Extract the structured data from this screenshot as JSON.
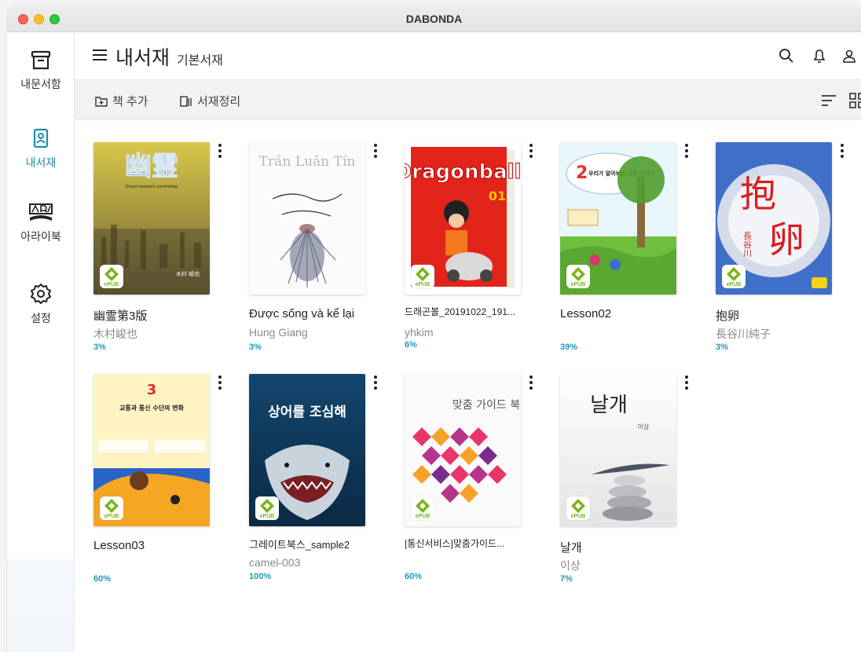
{
  "window": {
    "title": "DABONDA"
  },
  "sidebar": {
    "items": [
      {
        "label": "내문서함",
        "icon": "archive-box-icon",
        "active": false
      },
      {
        "label": "내서재",
        "icon": "bookshelf-icon",
        "active": true
      },
      {
        "label": "아라이북",
        "icon": "arabook-logo-icon",
        "active": false
      },
      {
        "label": "설정",
        "icon": "gear-icon",
        "active": false
      }
    ]
  },
  "header": {
    "title": "내서재",
    "subtitle": "기본서재",
    "icons": [
      "search-icon",
      "bell-icon",
      "user-icon"
    ]
  },
  "toolbar": {
    "add_book": "책 추가",
    "organize": "서재정리",
    "icons": [
      "sort-icon",
      "grid-view-icon"
    ]
  },
  "colors": {
    "accent": "#1f8bb0",
    "progress": "#1f9ab8",
    "epub": "#7ab51d"
  },
  "books": [
    {
      "title": "幽霊第3版",
      "author": "木村峻也",
      "progress": "3%"
    },
    {
      "title": "Được sống và kể lại",
      "author": "Hung Giang",
      "progress": "3%"
    },
    {
      "title": "드래곤볼_20191022_191...",
      "author": "yhkim",
      "progress": "6%"
    },
    {
      "title": "Lesson02",
      "author": "",
      "progress": "39%"
    },
    {
      "title": "抱卵",
      "author": "長谷川純子",
      "progress": "3%"
    },
    {
      "title": "Lesson03",
      "author": "",
      "progress": "60%"
    },
    {
      "title": "그레이트북스_sample2",
      "author": "camel-003",
      "progress": "100%"
    },
    {
      "title": "[통신서비스]맞춤가이드...",
      "author": "",
      "progress": "60%"
    },
    {
      "title": "날개",
      "author": "이상",
      "progress": "7%"
    }
  ],
  "covers": {
    "c0": {
      "main": "幽霊",
      "sub": "Ghost research committee",
      "name": "木村 峻也"
    },
    "c1": {
      "main": "Trần Luân Tín"
    },
    "c2": {
      "main": "Dragonball",
      "num": "01"
    },
    "c3": {
      "main": "우리가 알아보는 고장 이야기",
      "num": "2"
    },
    "c4": {
      "main": "抱",
      "main2": "卵",
      "side": "長谷川"
    },
    "c5": {
      "main": "교통과 통신 수단의 변화",
      "num": "3"
    },
    "c6": {
      "main": "상어를 조심해"
    },
    "c7": {
      "main": "맞춤 가이드 북"
    },
    "c8": {
      "main": "날개",
      "sub": "이상"
    },
    "epub_label": "ePUB"
  }
}
